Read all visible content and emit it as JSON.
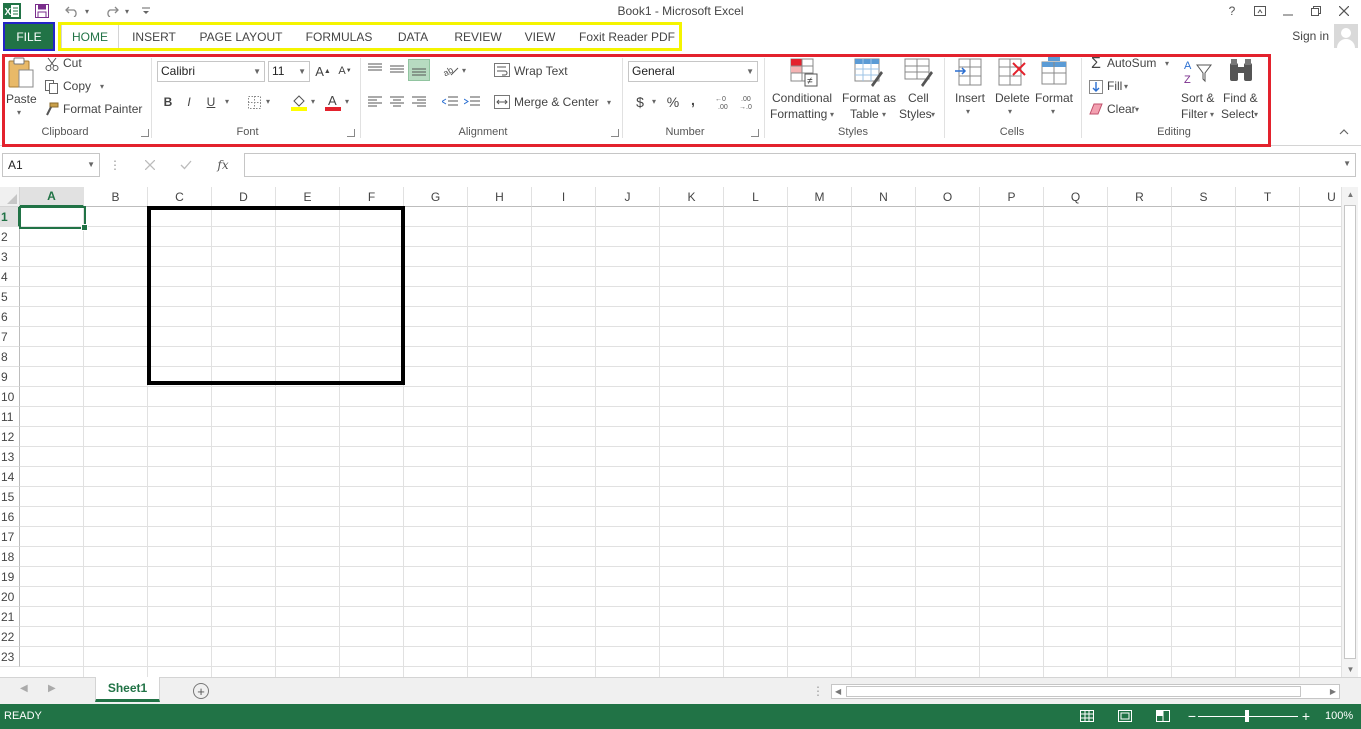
{
  "window": {
    "title": "Book1 - Microsoft Excel",
    "help": "?",
    "sign_in": "Sign in"
  },
  "ribbon_tabs": {
    "file": "FILE",
    "items": [
      "HOME",
      "INSERT",
      "PAGE LAYOUT",
      "FORMULAS",
      "DATA",
      "REVIEW",
      "VIEW",
      "Foxit Reader PDF"
    ],
    "active": "HOME"
  },
  "clipboard": {
    "paste": "Paste",
    "cut": "Cut",
    "copy": "Copy",
    "format_painter": "Format Painter",
    "label": "Clipboard"
  },
  "font": {
    "name": "Calibri",
    "size": "11",
    "bold": "B",
    "italic": "I",
    "underline": "U",
    "label": "Font"
  },
  "alignment": {
    "wrap_text": "Wrap Text",
    "merge_center": "Merge & Center",
    "label": "Alignment"
  },
  "number": {
    "format": "General",
    "currency": "$",
    "percent": "%",
    "comma": ",",
    "label": "Number"
  },
  "styles": {
    "conditional_1": "Conditional",
    "conditional_2": "Formatting",
    "format_table_1": "Format as",
    "format_table_2": "Table",
    "cell_styles_1": "Cell",
    "cell_styles_2": "Styles",
    "label": "Styles"
  },
  "cells": {
    "insert": "Insert",
    "delete": "Delete",
    "format": "Format",
    "label": "Cells"
  },
  "editing": {
    "autosum": "AutoSum",
    "fill": "Fill",
    "clear": "Clear",
    "sort_1": "Sort &",
    "sort_2": "Filter",
    "find_1": "Find &",
    "find_2": "Select",
    "label": "Editing"
  },
  "formula_bar": {
    "name_box": "A1",
    "fx": "fx",
    "value": ""
  },
  "grid": {
    "columns": [
      "A",
      "B",
      "C",
      "D",
      "E",
      "F",
      "G",
      "H",
      "I",
      "J",
      "K",
      "L",
      "M",
      "N",
      "O",
      "P",
      "Q",
      "R",
      "S",
      "T",
      "U"
    ],
    "rows": [
      "1",
      "2",
      "3",
      "4",
      "5",
      "6",
      "7",
      "8",
      "9",
      "10",
      "11",
      "12",
      "13",
      "14",
      "15",
      "16",
      "17",
      "18",
      "19",
      "20",
      "21",
      "22",
      "23"
    ],
    "active_cell": "A1",
    "outlined_range": "C1:F9"
  },
  "sheets": {
    "tabs": [
      "Sheet1"
    ],
    "active": "Sheet1"
  },
  "status": {
    "mode": "READY",
    "zoom": "100%"
  },
  "colors": {
    "excel_green": "#217346",
    "file_highlight": "#2323c8",
    "tabs_highlight": "#f4f400",
    "ribbon_highlight": "#e3222d"
  }
}
